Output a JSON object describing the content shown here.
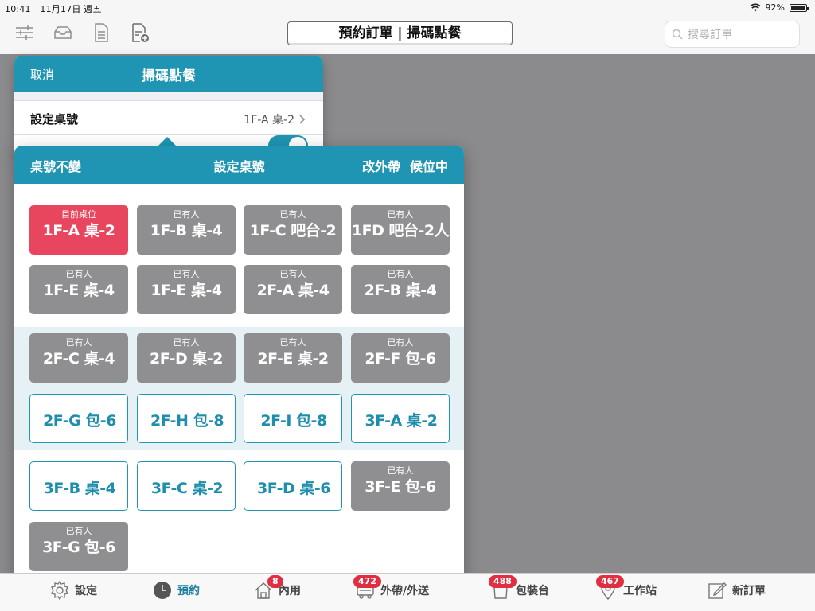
{
  "status": {
    "time": "10:41",
    "date": "11月17日 週五",
    "battery": "92%",
    "battery_level": 0.92
  },
  "nav": {
    "title": "預約訂單 | 掃碼點餐",
    "search_placeholder": "搜尋訂單"
  },
  "scan_popover": {
    "cancel": "取消",
    "title": "掃碼點餐",
    "row_label": "設定桌號",
    "row_value": "1F-A 桌-2"
  },
  "table_popover": {
    "left": "桌號不變",
    "title": "設定桌號",
    "right1": "改外帶",
    "right2": "候位中",
    "tiles": [
      {
        "status": "current",
        "tag": "目前桌位",
        "name": "1F-A 桌-2"
      },
      {
        "status": "occupied",
        "tag": "已有人",
        "name": "1F-B 桌-4"
      },
      {
        "status": "occupied",
        "tag": "已有人",
        "name": "1F-C 吧台-2"
      },
      {
        "status": "occupied",
        "tag": "已有人",
        "name": "1FD 吧台-2人"
      },
      {
        "status": "occupied",
        "tag": "已有人",
        "name": "1F-E 桌-4"
      },
      {
        "status": "occupied",
        "tag": "已有人",
        "name": "1F-E 桌-4"
      },
      {
        "status": "occupied",
        "tag": "已有人",
        "name": "2F-A 桌-4"
      },
      {
        "status": "occupied",
        "tag": "已有人",
        "name": "2F-B 桌-4"
      },
      {
        "status": "occupied",
        "tag": "已有人",
        "name": "2F-C 桌-4"
      },
      {
        "status": "occupied",
        "tag": "已有人",
        "name": "2F-D 桌-2"
      },
      {
        "status": "occupied",
        "tag": "已有人",
        "name": "2F-E 桌-2"
      },
      {
        "status": "occupied",
        "tag": "已有人",
        "name": "2F-F 包-6"
      },
      {
        "status": "free",
        "tag": "",
        "name": "2F-G 包-6"
      },
      {
        "status": "free",
        "tag": "",
        "name": "2F-H 包-8"
      },
      {
        "status": "free",
        "tag": "",
        "name": "2F-I 包-8"
      },
      {
        "status": "free",
        "tag": "",
        "name": "3F-A 桌-2"
      },
      {
        "status": "free",
        "tag": "",
        "name": "3F-B 桌-4"
      },
      {
        "status": "free",
        "tag": "",
        "name": "3F-C 桌-2"
      },
      {
        "status": "free",
        "tag": "",
        "name": "3F-D 桌-6"
      },
      {
        "status": "occupied",
        "tag": "已有人",
        "name": "3F-E 包-6"
      },
      {
        "status": "occupied",
        "tag": "已有人",
        "name": "3F-G 包-6"
      }
    ]
  },
  "tabs": [
    {
      "id": "settings",
      "label": "設定",
      "icon": "gear-icon",
      "badge": ""
    },
    {
      "id": "reservation",
      "label": "預約",
      "icon": "clock-icon",
      "badge": ""
    },
    {
      "id": "dine-in",
      "label": "內用",
      "icon": "house-icon",
      "badge": "8"
    },
    {
      "id": "takeout",
      "label": "外帶/外送",
      "icon": "delivery-icon",
      "badge": "472"
    },
    {
      "id": "packing",
      "label": "包裝台",
      "icon": "bag-icon",
      "badge": "488"
    },
    {
      "id": "station",
      "label": "工作站",
      "icon": "pin-icon",
      "badge": "467"
    },
    {
      "id": "new-order",
      "label": "新訂單",
      "icon": "pencil-icon",
      "badge": ""
    }
  ],
  "colors": {
    "accent": "#1f95b3",
    "current": "#e8465e",
    "occupied": "#8f8e90",
    "badge": "#e02f42"
  }
}
